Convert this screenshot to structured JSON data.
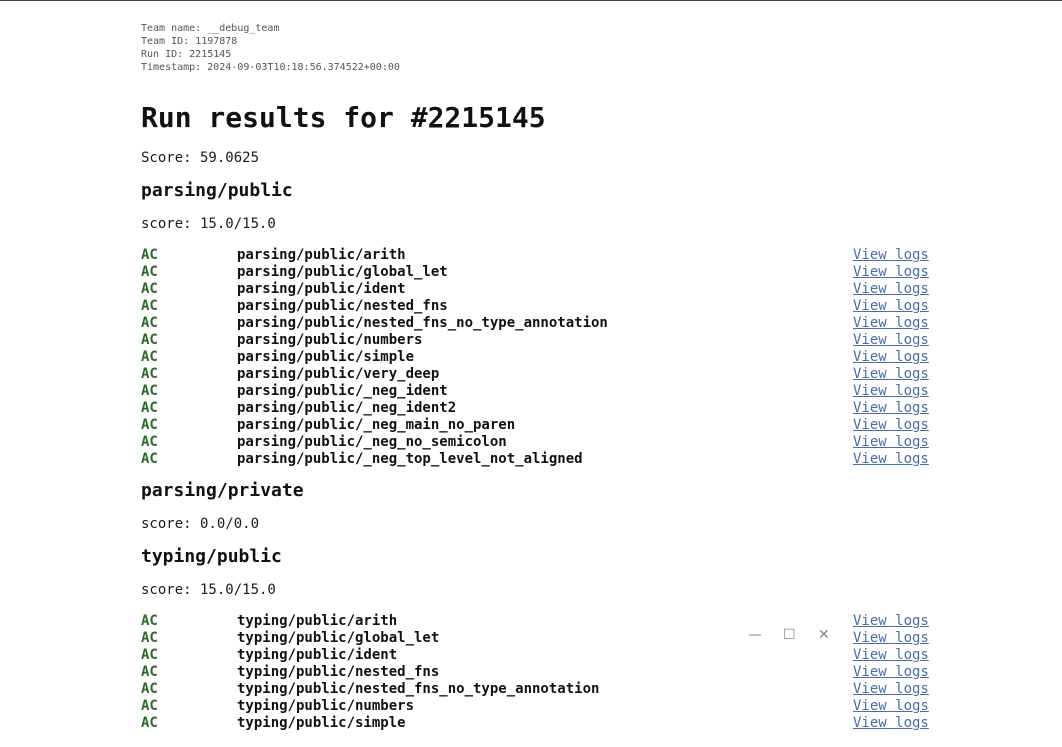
{
  "meta": {
    "team_name": "Team name: __debug_team",
    "team_id": "Team ID: 1197878",
    "run_id": "Run ID: 2215145",
    "timestamp": "Timestamp: 2024-09-03T10:18:56.374522+00:00"
  },
  "title": "Run results for #2215145",
  "score_total": "Score: 59.0625",
  "view_logs_label": "View logs",
  "window_controls": {
    "minimize": "—",
    "maximize": "☐",
    "close": "✕"
  },
  "sections": [
    {
      "name": "parsing/public",
      "score": "score: 15.0/15.0",
      "results": [
        {
          "status": "AC",
          "test": "parsing/public/arith"
        },
        {
          "status": "AC",
          "test": "parsing/public/global_let"
        },
        {
          "status": "AC",
          "test": "parsing/public/ident"
        },
        {
          "status": "AC",
          "test": "parsing/public/nested_fns"
        },
        {
          "status": "AC",
          "test": "parsing/public/nested_fns_no_type_annotation"
        },
        {
          "status": "AC",
          "test": "parsing/public/numbers"
        },
        {
          "status": "AC",
          "test": "parsing/public/simple"
        },
        {
          "status": "AC",
          "test": "parsing/public/very_deep"
        },
        {
          "status": "AC",
          "test": "parsing/public/_neg_ident"
        },
        {
          "status": "AC",
          "test": "parsing/public/_neg_ident2"
        },
        {
          "status": "AC",
          "test": "parsing/public/_neg_main_no_paren"
        },
        {
          "status": "AC",
          "test": "parsing/public/_neg_no_semicolon"
        },
        {
          "status": "AC",
          "test": "parsing/public/_neg_top_level_not_aligned"
        }
      ]
    },
    {
      "name": "parsing/private",
      "score": "score: 0.0/0.0",
      "results": []
    },
    {
      "name": "typing/public",
      "score": "score: 15.0/15.0",
      "results": [
        {
          "status": "AC",
          "test": "typing/public/arith"
        },
        {
          "status": "AC",
          "test": "typing/public/global_let"
        },
        {
          "status": "AC",
          "test": "typing/public/ident"
        },
        {
          "status": "AC",
          "test": "typing/public/nested_fns"
        },
        {
          "status": "AC",
          "test": "typing/public/nested_fns_no_type_annotation"
        },
        {
          "status": "AC",
          "test": "typing/public/numbers"
        },
        {
          "status": "AC",
          "test": "typing/public/simple"
        }
      ]
    }
  ]
}
